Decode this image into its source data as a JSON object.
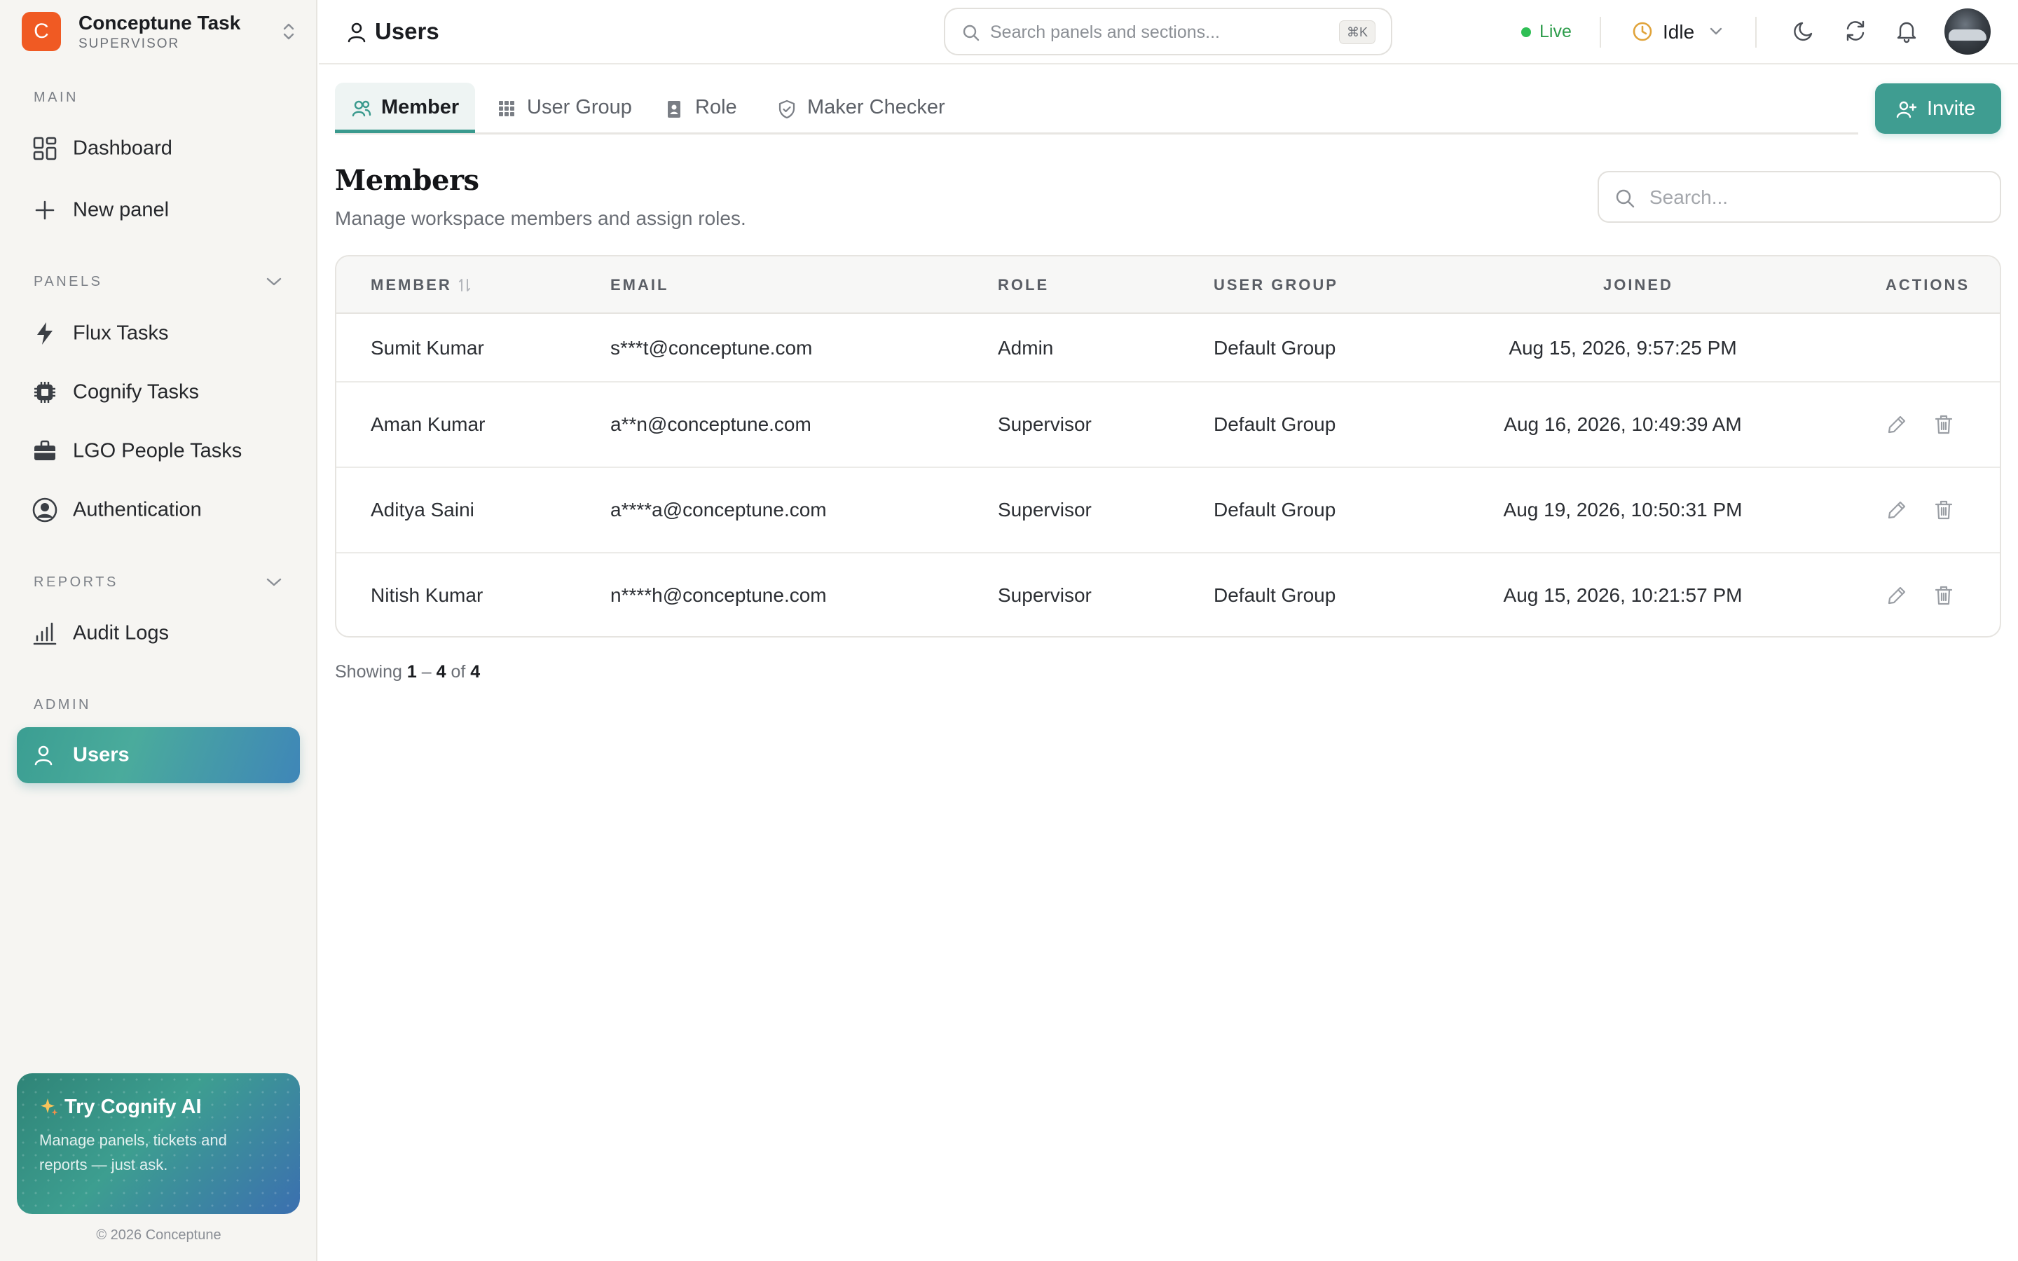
{
  "app": {
    "brand_letter": "C",
    "name": "Conceptune Task",
    "role": "SUPERVISOR"
  },
  "sidebar": {
    "sections": {
      "main": "MAIN",
      "panels": "PANELS",
      "reports": "REPORTS",
      "admin": "ADMIN"
    },
    "items": [
      {
        "label": "Dashboard",
        "icon": "dashboard-grid-icon"
      },
      {
        "label": "New panel",
        "icon": "plus-icon"
      },
      {
        "label": "Flux Tasks",
        "icon": "bolt-icon"
      },
      {
        "label": "Cognify Tasks",
        "icon": "chip-icon"
      },
      {
        "label": "LGO People Tasks",
        "icon": "briefcase-icon"
      },
      {
        "label": "Authentication",
        "icon": "user-circle-icon"
      },
      {
        "label": "Audit Logs",
        "icon": "bar-chart-icon"
      },
      {
        "label": "Users",
        "icon": "user-icon",
        "active": true
      }
    ],
    "promo": {
      "title": "Try Cognify AI",
      "text": "Manage panels, tickets and reports — just ask."
    },
    "copyright": "© 2026 Conceptune"
  },
  "topbar": {
    "page_title": "Users",
    "search_placeholder": "Search panels and sections...",
    "search_shortcut": "⌘K",
    "status_live": "Live",
    "status_idle": "Idle"
  },
  "tabs": [
    {
      "label": "Member",
      "icon": "users-icon",
      "active": true
    },
    {
      "label": "User Group",
      "icon": "grid-icon"
    },
    {
      "label": "Role",
      "icon": "id-badge-icon"
    },
    {
      "label": "Maker Checker",
      "icon": "shield-icon"
    }
  ],
  "invite_label": "Invite",
  "members": {
    "title": "Members",
    "subtitle": "Manage workspace members and assign roles.",
    "search_placeholder": "Search...",
    "columns": {
      "member": "MEMBER",
      "email": "EMAIL",
      "role": "ROLE",
      "group": "USER GROUP",
      "joined": "JOINED",
      "actions": "ACTIONS"
    },
    "rows": [
      {
        "name": "Sumit Kumar",
        "email": "s***t@conceptune.com",
        "role": "Admin",
        "group": "Default Group",
        "joined": "Aug 15, 2026, 9:57:25 PM",
        "actions": false
      },
      {
        "name": "Aman Kumar",
        "email": "a**n@conceptune.com",
        "role": "Supervisor",
        "group": "Default Group",
        "joined": "Aug 16, 2026, 10:49:39 AM",
        "actions": true
      },
      {
        "name": "Aditya Saini",
        "email": "a****a@conceptune.com",
        "role": "Supervisor",
        "group": "Default Group",
        "joined": "Aug 19, 2026, 10:50:31 PM",
        "actions": true
      },
      {
        "name": "Nitish Kumar",
        "email": "n****h@conceptune.com",
        "role": "Supervisor",
        "group": "Default Group",
        "joined": "Aug 15, 2026, 10:21:57 PM",
        "actions": true
      }
    ]
  },
  "pager": {
    "prefix": "Showing",
    "from": "1",
    "dash": "–",
    "to": "4",
    "of": "of",
    "total": "4"
  },
  "colors": {
    "accent": "#3f9d91",
    "brand": "#f05a23",
    "live": "#2fbf55",
    "idle": "#e0a33a"
  }
}
